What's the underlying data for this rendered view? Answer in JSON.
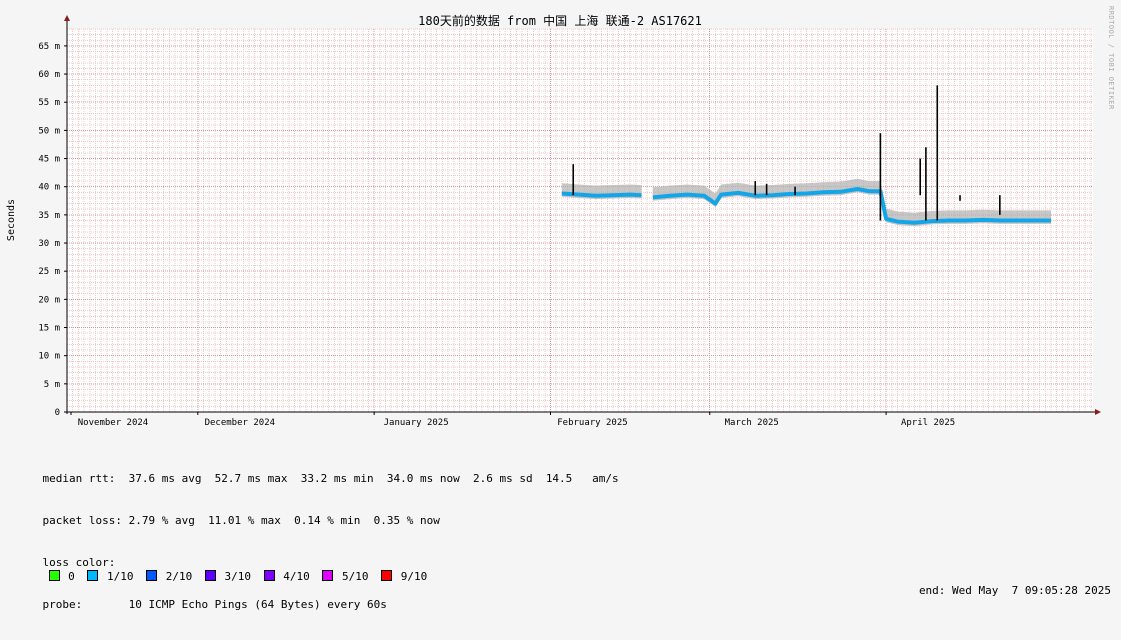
{
  "chart_data": {
    "type": "line",
    "title": "180天前的数据 from 中国 上海 联通-2 AS17621",
    "ylabel": "Seconds",
    "watermark": "RRDTOOL / TOBI OETIKER",
    "ylim": [
      0,
      68
    ],
    "xlim": [
      "2024-11-08",
      "2025-05-07"
    ],
    "y_ticks": [
      {
        "value": 0,
        "label": "0"
      },
      {
        "value": 5,
        "label": "5 m"
      },
      {
        "value": 10,
        "label": "10 m"
      },
      {
        "value": 15,
        "label": "15 m"
      },
      {
        "value": 20,
        "label": "20 m"
      },
      {
        "value": 25,
        "label": "25 m"
      },
      {
        "value": 30,
        "label": "30 m"
      },
      {
        "value": 35,
        "label": "35 m"
      },
      {
        "value": 40,
        "label": "40 m"
      },
      {
        "value": 45,
        "label": "45 m"
      },
      {
        "value": 50,
        "label": "50 m"
      },
      {
        "value": 55,
        "label": "55 m"
      },
      {
        "value": 60,
        "label": "60 m"
      },
      {
        "value": 65,
        "label": "65 m"
      }
    ],
    "x_ticks": [
      {
        "date": "2024-11-01",
        "label": "November 2024"
      },
      {
        "date": "2024-12-01",
        "label": "December 2024"
      },
      {
        "date": "2025-01-01",
        "label": "January 2025"
      },
      {
        "date": "2025-02-01",
        "label": "February 2025"
      },
      {
        "date": "2025-03-01",
        "label": "March 2025"
      },
      {
        "date": "2025-04-01",
        "label": "April 2025"
      }
    ],
    "grid": true,
    "median_series": [
      {
        "points": [
          {
            "x": "2025-02-03",
            "y": 38.8
          },
          {
            "x": "2025-02-06",
            "y": 38.6
          },
          {
            "x": "2025-02-09",
            "y": 38.4
          },
          {
            "x": "2025-02-12",
            "y": 38.5
          },
          {
            "x": "2025-02-15",
            "y": 38.6
          },
          {
            "x": "2025-02-17",
            "y": 38.5
          }
        ]
      },
      {
        "points": [
          {
            "x": "2025-02-19",
            "y": 38.1
          },
          {
            "x": "2025-02-22",
            "y": 38.4
          },
          {
            "x": "2025-02-25",
            "y": 38.6
          },
          {
            "x": "2025-02-28",
            "y": 38.4
          },
          {
            "x": "2025-03-02",
            "y": 37.0
          },
          {
            "x": "2025-03-03",
            "y": 38.6
          },
          {
            "x": "2025-03-06",
            "y": 38.9
          },
          {
            "x": "2025-03-09",
            "y": 38.4
          },
          {
            "x": "2025-03-12",
            "y": 38.5
          },
          {
            "x": "2025-03-15",
            "y": 38.7
          },
          {
            "x": "2025-03-18",
            "y": 38.8
          },
          {
            "x": "2025-03-21",
            "y": 39.0
          },
          {
            "x": "2025-03-24",
            "y": 39.1
          },
          {
            "x": "2025-03-27",
            "y": 39.6
          },
          {
            "x": "2025-03-29",
            "y": 39.2
          },
          {
            "x": "2025-03-31",
            "y": 39.2
          },
          {
            "x": "2025-04-01",
            "y": 34.3
          },
          {
            "x": "2025-04-03",
            "y": 33.8
          },
          {
            "x": "2025-04-06",
            "y": 33.6
          },
          {
            "x": "2025-04-09",
            "y": 33.9
          },
          {
            "x": "2025-04-12",
            "y": 34.0
          },
          {
            "x": "2025-04-15",
            "y": 34.0
          },
          {
            "x": "2025-04-18",
            "y": 34.1
          },
          {
            "x": "2025-04-21",
            "y": 34.0
          },
          {
            "x": "2025-04-24",
            "y": 34.0
          },
          {
            "x": "2025-04-27",
            "y": 34.0
          },
          {
            "x": "2025-04-30",
            "y": 34.0
          }
        ]
      }
    ],
    "spikes": [
      {
        "x": "2025-02-05",
        "y": 44.0
      },
      {
        "x": "2025-03-09",
        "y": 41.0
      },
      {
        "x": "2025-03-11",
        "y": 40.5
      },
      {
        "x": "2025-03-16",
        "y": 40.0
      },
      {
        "x": "2025-03-31",
        "y": 49.5
      },
      {
        "x": "2025-04-07",
        "y": 45.0
      },
      {
        "x": "2025-04-08",
        "y": 47.0
      },
      {
        "x": "2025-04-10",
        "y": 58.0
      },
      {
        "x": "2025-04-14",
        "y": 37.5
      },
      {
        "x": "2025-04-21",
        "y": 35.0
      }
    ],
    "colors": {
      "background": "#f5f5f5",
      "plot_background": "#ffffff",
      "minor_grid": "#f0c8c8",
      "major_grid": "#d89898",
      "axis": "#000000",
      "arrow": "#8b1a1a",
      "median": "#12a6e8",
      "smoke": "#b4b4b4",
      "spike": "#000000"
    }
  },
  "legend": {
    "median_rtt": "median rtt:  37.6 ms avg  52.7 ms max  33.2 ms min  34.0 ms now  2.6 ms sd  14.5   am/s",
    "packet_loss": "packet loss: 2.79 % avg  11.01 % max  0.14 % min  0.35 % now",
    "loss_color_label": "loss color:",
    "loss_colors": [
      {
        "label": "0",
        "color": "#26ff00"
      },
      {
        "label": "1/10",
        "color": "#00b8ff"
      },
      {
        "label": "2/10",
        "color": "#0059ff"
      },
      {
        "label": "3/10",
        "color": "#5e00ff"
      },
      {
        "label": "4/10",
        "color": "#7e00ff"
      },
      {
        "label": "5/10",
        "color": "#dd00ff"
      },
      {
        "label": "9/10",
        "color": "#ff0000"
      }
    ],
    "probe": "probe:       10 ICMP Echo Pings (64 Bytes) every 60s",
    "end": "end: Wed May  7 09:05:28 2025"
  }
}
